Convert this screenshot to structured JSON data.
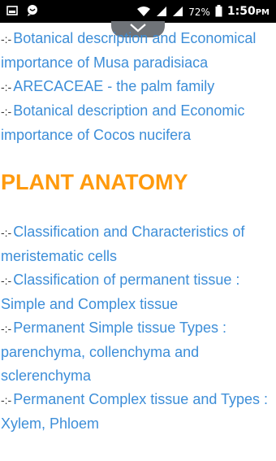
{
  "status_bar": {
    "battery_percent": "72%",
    "time": "1:50",
    "time_suffix": "PM",
    "icons": [
      "image-icon",
      "chat-icon",
      "wifi-icon",
      "signal-icon",
      "battery-icon"
    ]
  },
  "top_items": [
    {
      "bullet": "-:-",
      "text": "Botanical description and Economical importance of Musa paradisiaca"
    },
    {
      "bullet": "-:-",
      "text": "ARECACEAE - the palm family"
    },
    {
      "bullet": "-:-",
      "text": "Botanical description and Economic importance of Cocos nucifera"
    }
  ],
  "section_heading": "PLANT ANATOMY",
  "section_items": [
    {
      "bullet": "-:-",
      "text": "Classification and Characteristics of meristematic cells"
    },
    {
      "bullet": "-:-",
      "text": "Classification of permanent tissue : Simple and Complex tissue"
    },
    {
      "bullet": "-:-",
      "text": "Permanent Simple tissue Types : parenchyma, collenchyma and sclerenchyma"
    },
    {
      "bullet": "-:-",
      "text": "Permanent Complex tissue and Types : Xylem, Phloem"
    }
  ],
  "colors": {
    "link": "#3d8ed8",
    "heading": "#ff9a0d",
    "status_bar": "#000000",
    "pull_tab": "#6f7378"
  }
}
